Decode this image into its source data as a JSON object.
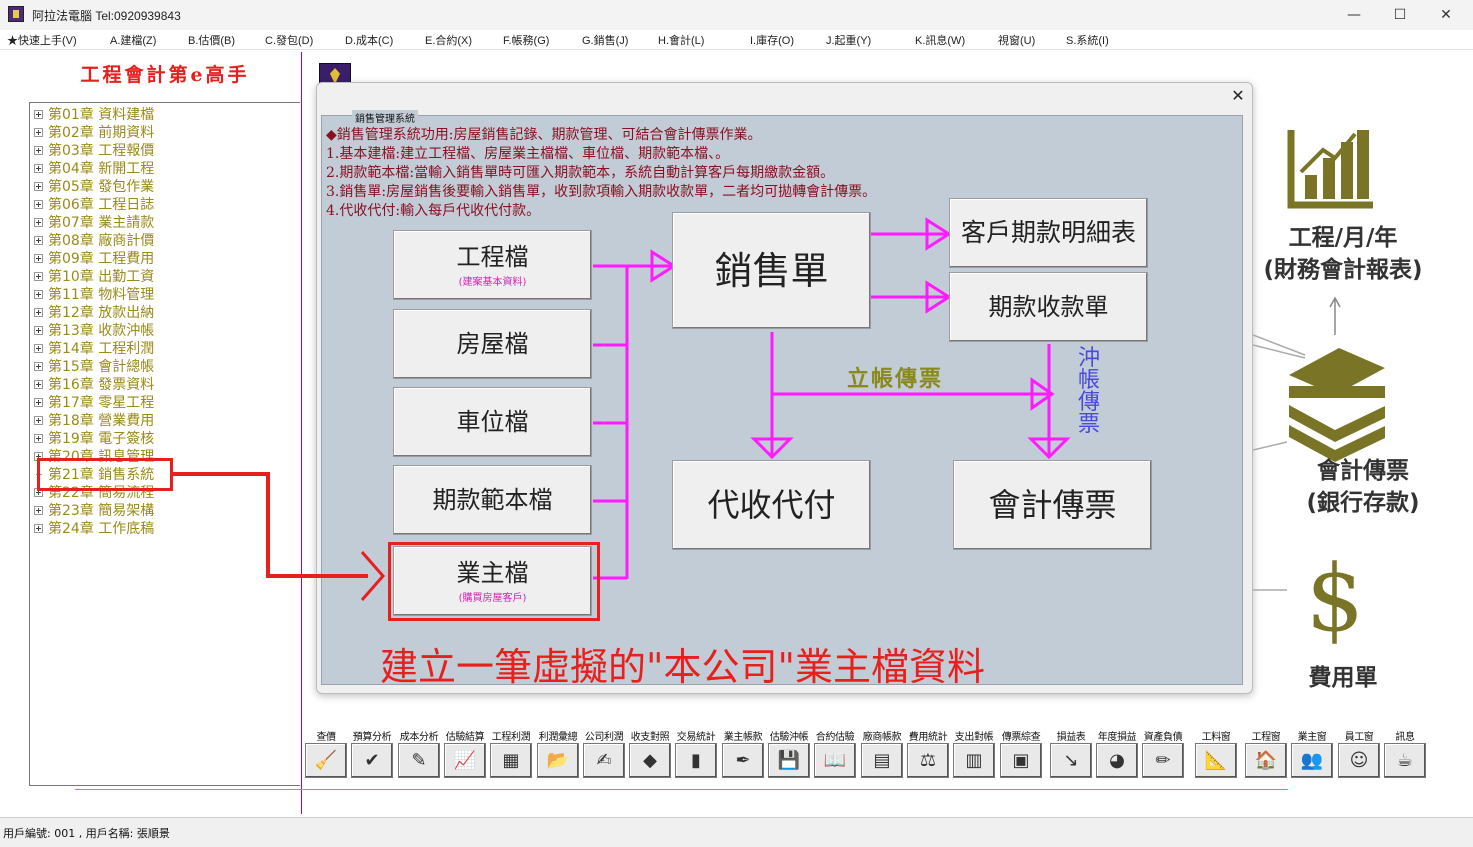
{
  "window": {
    "title": "阿拉法電腦 Tel:0920939843",
    "controls": {
      "minimize": "—",
      "maximize": "☐",
      "close": "✕"
    }
  },
  "menu": [
    "★快速上手(V)",
    "A.建檔(Z)",
    "B.估價(B)",
    "C.發包(D)",
    "D.成本(C)",
    "E.合約(X)",
    "F.帳務(G)",
    "G.銷售(J)",
    "H.會計(L)",
    "I.庫存(O)",
    "J.起重(Y)",
    "K.訊息(W)",
    "視窗(U)",
    "S.系統(I)"
  ],
  "left": {
    "title": "工程會計第e高手",
    "chapters": [
      "第01章 資料建檔",
      "第02章 前期資料",
      "第03章 工程報價",
      "第04章 新開工程",
      "第05章 發包作業",
      "第06章 工程日誌",
      "第07章 業主請款",
      "第08章 廠商計價",
      "第09章 工程費用",
      "第10章 出勤工資",
      "第11章 物料管理",
      "第12章 放款出納",
      "第13章 收款沖帳",
      "第14章 工程利潤",
      "第15章 會計總帳",
      "第16章 發票資料",
      "第17章 零星工程",
      "第18章 營業費用",
      "第19章 電子簽核",
      "第20章 訊息管理",
      "第21章 銷售系統",
      "第22章 簡易流程",
      "第23章 簡易架構",
      "第24章 工作底稿"
    ],
    "active_index": 20
  },
  "dialog": {
    "frame_title": "銷售管理系統",
    "close": "✕",
    "description": [
      "◆銷售管理系統功用:房屋銷售記錄、期款管理、可結合會計傳票作業。",
      "1.基本建檔:建立工程檔、房屋業主檔檔、車位檔、期款範本檔、。",
      "2.期款範本檔:當輸入銷售單時可匯入期款範本，系統自動計算客戶每期繳款金額。",
      "3.銷售單:房屋銷售後要輸入銷售單，收到款項輸入期款收款單，二者均可拋轉會計傳票。",
      "4.代收代付:輸入每戶代收代付款。"
    ],
    "buttons": {
      "project": {
        "label": "工程檔",
        "sub": "(建案基本資料)"
      },
      "house": {
        "label": "房屋檔"
      },
      "parking": {
        "label": "車位檔"
      },
      "template": {
        "label": "期款範本檔"
      },
      "owner": {
        "label": "業主檔",
        "sub": "(購買房屋客戶)"
      },
      "sales": {
        "label": "銷售單"
      },
      "customer_detail": {
        "label": "客戶期款明細表"
      },
      "receipt": {
        "label": "期款收款單"
      },
      "proxy": {
        "label": "代收代付"
      },
      "voucher": {
        "label": "會計傳票"
      }
    },
    "label_lizhang": "立帳傳票",
    "label_chongzhang": "沖帳傳票",
    "caption": "建立一筆虛擬的\"本公司\"業主檔資料"
  },
  "right": {
    "report_label": [
      "工程/月/年",
      "(財務會計報表)"
    ],
    "voucher_label": [
      "會計傳票",
      "(銀行存款)"
    ],
    "expense_label": "費用單",
    "icon_color": "#7a7526"
  },
  "toolbar": [
    {
      "label": "查價",
      "icon": "broom-icon",
      "glyph": "🧹"
    },
    {
      "label": "預算分析",
      "icon": "checklist-icon",
      "glyph": "✔"
    },
    {
      "label": "成本分析",
      "icon": "chart-icon",
      "glyph": "✎"
    },
    {
      "label": "估驗結算",
      "icon": "graph-icon",
      "glyph": "📈"
    },
    {
      "label": "工程利潤",
      "icon": "calc-icon",
      "glyph": "▦"
    },
    {
      "label": "利潤彙總",
      "icon": "folder-icon",
      "glyph": "📂"
    },
    {
      "label": "公司利潤",
      "icon": "pen-icon",
      "glyph": "✍"
    },
    {
      "label": "收支對照",
      "icon": "eraser-icon",
      "glyph": "◆"
    },
    {
      "label": "交易統計",
      "icon": "bars-icon",
      "glyph": "▮"
    },
    {
      "label": "業主帳款",
      "icon": "write-icon",
      "glyph": "✒"
    },
    {
      "label": "估驗沖帳",
      "icon": "disk-icon",
      "glyph": "💾"
    },
    {
      "label": "合約估驗",
      "icon": "book-icon",
      "glyph": "📖"
    },
    {
      "label": "廠商帳款",
      "icon": "scanner-icon",
      "glyph": "▤"
    },
    {
      "label": "費用統計",
      "icon": "compass-icon",
      "glyph": "⚖"
    },
    {
      "label": "支出對帳",
      "icon": "stack-icon",
      "glyph": "▥"
    },
    {
      "label": "傳票綜查",
      "icon": "cube-icon",
      "glyph": "▣"
    },
    {
      "label": "損益表",
      "icon": "arrow-icon",
      "glyph": "↘"
    },
    {
      "label": "年度損益",
      "icon": "pie-icon",
      "glyph": "◕"
    },
    {
      "label": "資產負債",
      "icon": "notebook-icon",
      "glyph": "✏"
    },
    {
      "label": "工料窗",
      "icon": "ruler-icon",
      "glyph": "📐"
    },
    {
      "label": "工程窗",
      "icon": "house-icon",
      "glyph": "🏠"
    },
    {
      "label": "業主窗",
      "icon": "people-icon",
      "glyph": "👥"
    },
    {
      "label": "員工窗",
      "icon": "face-icon",
      "glyph": "☺"
    },
    {
      "label": "訊息",
      "icon": "cup-icon",
      "glyph": "☕"
    }
  ],
  "status": "用戶編號: 001 , 用戶名稱: 張順景"
}
